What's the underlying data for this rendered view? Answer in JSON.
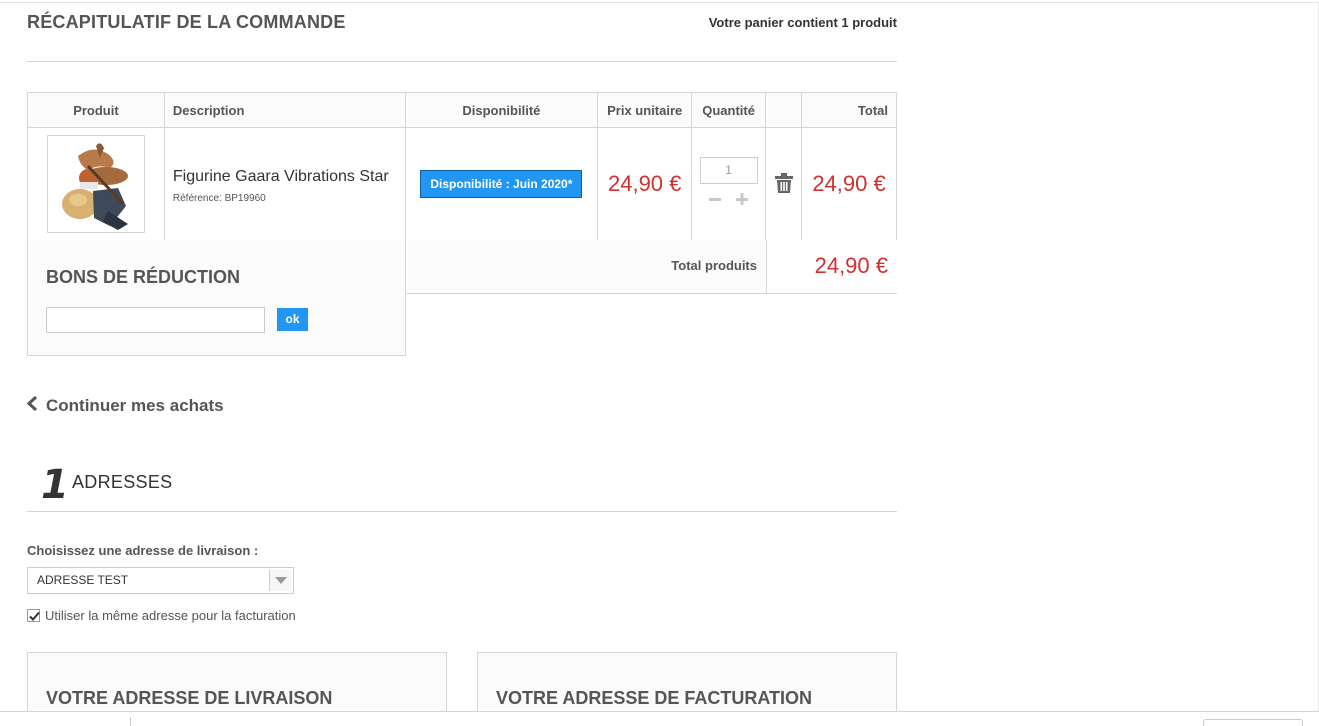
{
  "summary": {
    "title": "RÉCAPITULATIF DE LA COMMANDE",
    "cart_count": "Votre panier contient 1 produit"
  },
  "cart_table": {
    "headers": {
      "product": "Produit",
      "description": "Description",
      "availability": "Disponibilité",
      "unit_price": "Prix unitaire",
      "quantity": "Quantité",
      "total": "Total"
    },
    "items": [
      {
        "name": "Figurine Gaara Vibrations Star",
        "reference": "Référence: BP19960",
        "availability": "Disponibilité : Juin 2020*",
        "unit_price": "24,90 €",
        "quantity": "1",
        "total": "24,90 €",
        "image_icon": "gaara-figurine-image",
        "delete_icon": "trash-icon"
      }
    ],
    "total_products_label": "Total produits",
    "total_products_value": "24,90 €"
  },
  "voucher": {
    "title": "BONS DE RÉDUCTION",
    "input_value": "",
    "ok_label": "ok"
  },
  "continue_shopping": "Continuer mes achats",
  "step": {
    "number": "1",
    "title": "ADRESSES"
  },
  "addresses": {
    "delivery_label": "Choisissez une adresse de livraison :",
    "selected_address": "ADRESSE TEST",
    "same_billing_label": "Utiliser la même adresse pour la facturation",
    "same_billing_checked": true,
    "delivery_box_title": "VOTRE ADRESSE DE LIVRAISON",
    "billing_box_title": "VOTRE ADRESSE DE FACTURATION"
  },
  "colors": {
    "accent_blue": "#2196f3",
    "price_red": "#d32f2f",
    "border_grey": "#d6d4d4"
  }
}
